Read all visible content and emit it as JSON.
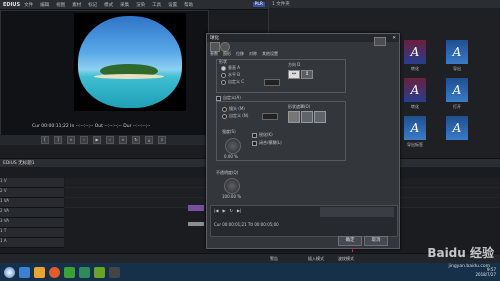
{
  "menubar": {
    "app": "EDIUS",
    "items": [
      "文件",
      "编辑",
      "视图",
      "素材",
      "标记",
      "模式",
      "采集",
      "渲染",
      "工具",
      "设置",
      "帮助"
    ],
    "plr": "PLR"
  },
  "player": {
    "timecode": "Cur 00:00:11;22    In --:--:--;--    Out --:--:--;--    Dur --:--:--;--"
  },
  "bins": {
    "title": "1 文件夹",
    "thumb_letter": "A",
    "thumb_labels": [
      "转化",
      "导出",
      "转化",
      "导出标签",
      "打开"
    ]
  },
  "timeline": {
    "title": "EDIUS 无标题1",
    "tracks": [
      "1 V",
      "2 V",
      "1 VA",
      "2 VA",
      "3 VA",
      "1 T",
      "1 A"
    ]
  },
  "dialog": {
    "title": "球化",
    "tabs": [
      "参数",
      "图形",
      "位移",
      "对称",
      "其他设置"
    ],
    "section_shape": "形状",
    "radio1": "垂直 A",
    "radio2": "水平 B",
    "radio3": "自定义 C",
    "section_direction": "方向 D",
    "section_distort": "自定义(A)",
    "sub_radio1": "镜头 (M)",
    "sub_radio2": "自定义 (N)",
    "section_mask": "形状遮罩(O)",
    "label_strength": "强度(S)",
    "chk1": "锐化(K)",
    "chk2": "闭合/模糊(L)",
    "knob_value": "0.00 %",
    "section_opacity": "不透明度(Q)",
    "opacity_value": "100.00 %",
    "ok": "确定",
    "cancel": "取消",
    "preview_tc": "Cur 00:00:01;21   Ttl 00:00:05;00"
  },
  "statusbar": {
    "items": [
      "警告",
      "插入模式",
      "波纹模式"
    ]
  },
  "taskbar": {
    "time": "9:57",
    "date": "2018/7/27"
  },
  "watermark": {
    "brand": "Baidu 经验",
    "site": "jingyan.baidu.com"
  },
  "colors": {
    "accent": "#3b4fa0",
    "taskbar": "#16304a"
  }
}
